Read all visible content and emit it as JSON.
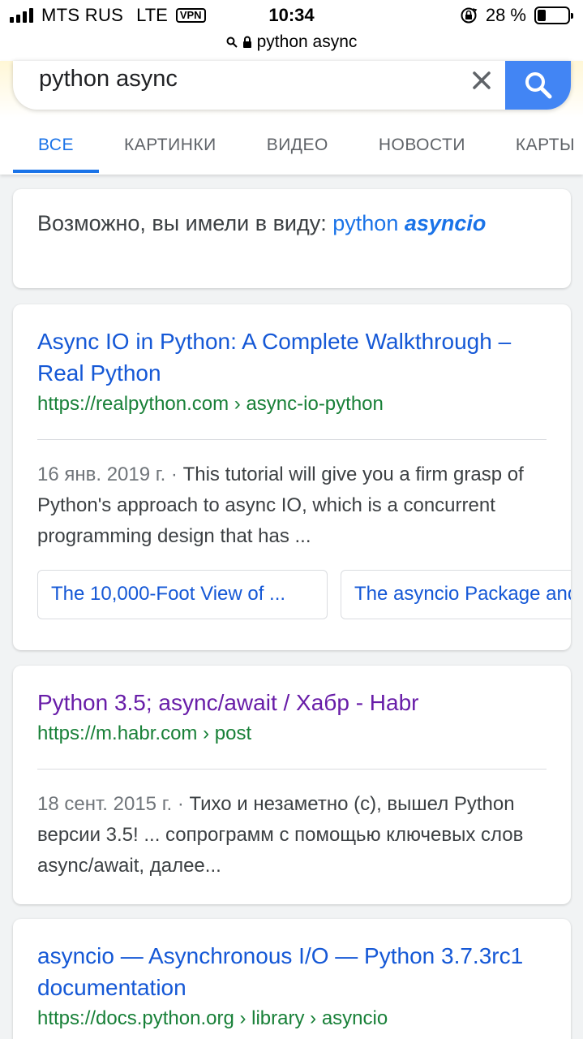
{
  "status_bar": {
    "carrier": "MTS RUS",
    "network": "LTE",
    "vpn": "VPN",
    "time": "10:34",
    "battery": "28 %",
    "battery_level": 0.28,
    "url": "python async"
  },
  "search": {
    "query": "python async"
  },
  "tabs": [
    {
      "label": "ВСЕ",
      "active": true
    },
    {
      "label": "КАРТИНКИ"
    },
    {
      "label": "ВИДЕО"
    },
    {
      "label": "НОВОСТИ"
    },
    {
      "label": "КАРТЫ"
    }
  ],
  "did_you_mean": {
    "prefix": "Возможно, вы имели в виду:",
    "word1": "python",
    "word2": "asyncio"
  },
  "results": [
    {
      "title": "Async IO in Python: A Complete Walkthrough – Real Python",
      "url": "https://realpython.com › async-io-python",
      "date": "16 янв. 2019 г. ·",
      "snippet": "This tutorial will give you a firm grasp of Python's approach to async IO, which is a concurrent programming design that has ...",
      "sitelinks": [
        "The 10,000-Foot View of ...",
        "The asyncio Package and ..."
      ]
    },
    {
      "title": "Python 3.5; async/await / Хабр - Habr",
      "url": "https://m.habr.com › post",
      "date": "18 сент. 2015 г. ·",
      "snippet": "Тихо и незаметно (с), вышел Python версии 3.5! ... сопрограмм с помощью ключевых слов async/await, далее..."
    },
    {
      "title": "asyncio — Asynchronous I/O — Python 3.7.3rc1 documentation",
      "url": "https://docs.python.org › library › asyncio"
    }
  ]
}
